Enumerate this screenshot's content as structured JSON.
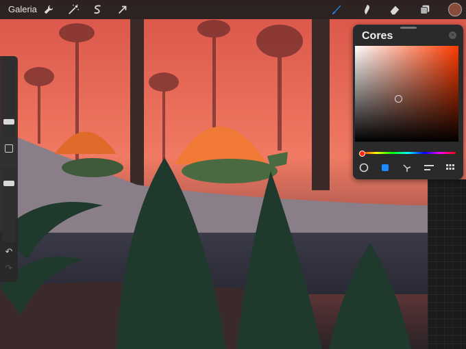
{
  "toolbar": {
    "gallery": "Galeria"
  },
  "colors_panel": {
    "title": "Cores",
    "current_color": "#8a4a3a"
  },
  "theme": {
    "accent": "#1a8cff",
    "bar": "#1e1e1e",
    "sky": "#e05a4a"
  }
}
